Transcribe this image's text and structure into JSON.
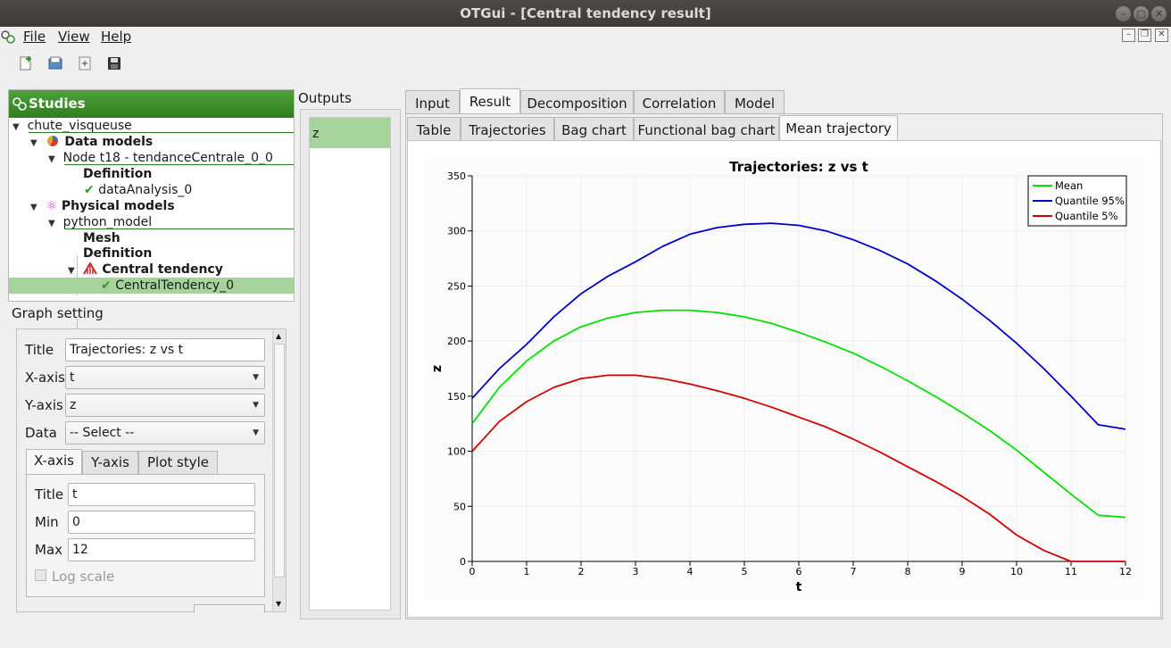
{
  "window": {
    "title": "OTGui - [Central tendency result]"
  },
  "menu": {
    "file": "File",
    "view": "View",
    "help": "Help"
  },
  "studies": {
    "header": "Studies",
    "tree": [
      {
        "label": "chute_visqueuse"
      },
      {
        "label": "Data models"
      },
      {
        "label": "Node t18 - tendanceCentrale_0_0"
      },
      {
        "label": "Definition"
      },
      {
        "label": "dataAnalysis_0"
      },
      {
        "label": "Physical models"
      },
      {
        "label": "python_model"
      },
      {
        "label": "Mesh"
      },
      {
        "label": "Definition"
      },
      {
        "label": "Central tendency"
      },
      {
        "label": "CentralTendency_0"
      }
    ]
  },
  "graph_setting": {
    "label": "Graph setting",
    "title_label": "Title",
    "title_value": "Trajectories: z vs t",
    "xaxis_label": "X-axis",
    "xaxis_value": "t",
    "yaxis_label": "Y-axis",
    "yaxis_value": "z",
    "data_label": "Data",
    "data_value": "-- Select --",
    "tabs": [
      "X-axis",
      "Y-axis",
      "Plot style"
    ],
    "axis_title_label": "Title",
    "axis_title_value": "t",
    "min_label": "Min",
    "min_value": "0",
    "max_label": "Max",
    "max_value": "12",
    "log_scale_label": "Log scale"
  },
  "outputs": {
    "label": "Outputs",
    "items": [
      "z"
    ]
  },
  "main_tabs": [
    "Input",
    "Result",
    "Decomposition",
    "Correlation",
    "Model"
  ],
  "sub_tabs": [
    "Table",
    "Trajectories",
    "Bag chart",
    "Functional bag chart",
    "Mean trajectory"
  ],
  "colors": {
    "mean": "#00e000",
    "q95": "#0000c8",
    "q5": "#d40000",
    "accent": "#3a8f29"
  },
  "chart_data": {
    "type": "line",
    "title": "Trajectories: z vs t",
    "xlabel": "t",
    "ylabel": "z",
    "xlim": [
      0,
      12
    ],
    "ylim": [
      0,
      350
    ],
    "xticks": [
      0,
      1,
      2,
      3,
      4,
      5,
      6,
      7,
      8,
      9,
      10,
      11,
      12
    ],
    "yticks": [
      0,
      50,
      100,
      150,
      200,
      250,
      300,
      350
    ],
    "grid": true,
    "legend_position": "top-right",
    "series": [
      {
        "name": "Mean",
        "color": "#00e000",
        "x": [
          0,
          0.5,
          1,
          1.5,
          2,
          2.5,
          3,
          3.5,
          4,
          4.5,
          5,
          5.5,
          6,
          6.5,
          7,
          7.5,
          8,
          8.5,
          9,
          9.5,
          10,
          10.5,
          11,
          11.5,
          12
        ],
        "y": [
          125,
          158,
          182,
          200,
          213,
          221,
          226,
          228,
          228,
          226,
          222,
          216,
          208,
          199,
          189,
          177,
          164,
          150,
          135,
          119,
          101,
          81,
          61,
          42,
          40
        ]
      },
      {
        "name": "Quantile 95%",
        "color": "#0000c8",
        "x": [
          0,
          0.5,
          1,
          1.5,
          2,
          2.5,
          3,
          3.5,
          4,
          4.5,
          5,
          5.5,
          6,
          6.5,
          7,
          7.5,
          8,
          8.5,
          9,
          9.5,
          10,
          10.5,
          11,
          11.5,
          12
        ],
        "y": [
          148,
          175,
          197,
          222,
          243,
          259,
          272,
          286,
          297,
          303,
          306,
          307,
          305,
          300,
          292,
          282,
          270,
          255,
          238,
          219,
          198,
          175,
          150,
          124,
          120
        ]
      },
      {
        "name": "Quantile 5%",
        "color": "#d40000",
        "x": [
          0,
          0.5,
          1,
          1.5,
          2,
          2.5,
          3,
          3.5,
          4,
          4.5,
          5,
          5.5,
          6,
          6.5,
          7,
          7.5,
          8,
          8.5,
          9,
          9.5,
          10,
          10.5,
          11,
          11.5,
          12
        ],
        "y": [
          100,
          127,
          145,
          158,
          166,
          169,
          169,
          166,
          161,
          155,
          148,
          140,
          131,
          122,
          111,
          99,
          86,
          73,
          59,
          43,
          24,
          10,
          0,
          0,
          0
        ]
      }
    ]
  }
}
